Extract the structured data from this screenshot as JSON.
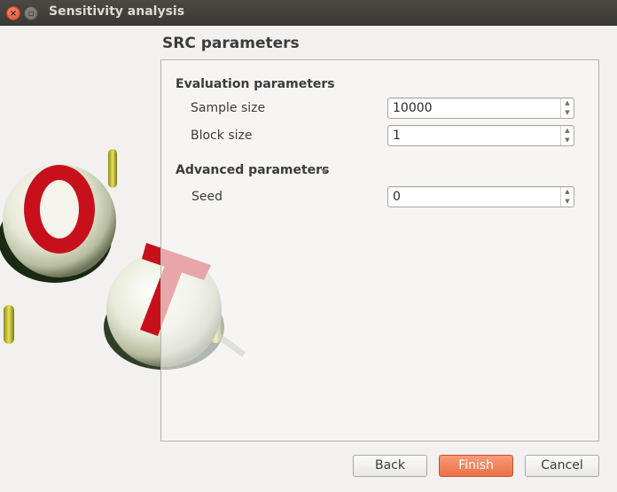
{
  "window": {
    "title": "Sensitivity analysis",
    "close_glyph": "×",
    "minimize_glyph": "▫"
  },
  "page": {
    "title": "SRC parameters"
  },
  "evaluation": {
    "title": "Evaluation parameters",
    "sample_size_label": "Sample size",
    "sample_size_value": "10000",
    "block_size_label": "Block size",
    "block_size_value": "1"
  },
  "advanced": {
    "title": "Advanced parameters",
    "expanded": true,
    "seed_label": "Seed",
    "seed_value": "0"
  },
  "spin": {
    "up_glyph": "▲",
    "down_glyph": "▼"
  },
  "buttons": {
    "back": "Back",
    "finish": "Finish",
    "cancel": "Cancel"
  },
  "colors": {
    "accent": "#ec7047",
    "titlebar": "#3f3e3a",
    "logo_red": "#c8101c"
  },
  "icons": {
    "logo": "ot-logo-icon",
    "close": "close-icon",
    "minimize": "minimize-icon",
    "expander": "chevron-down-icon"
  }
}
